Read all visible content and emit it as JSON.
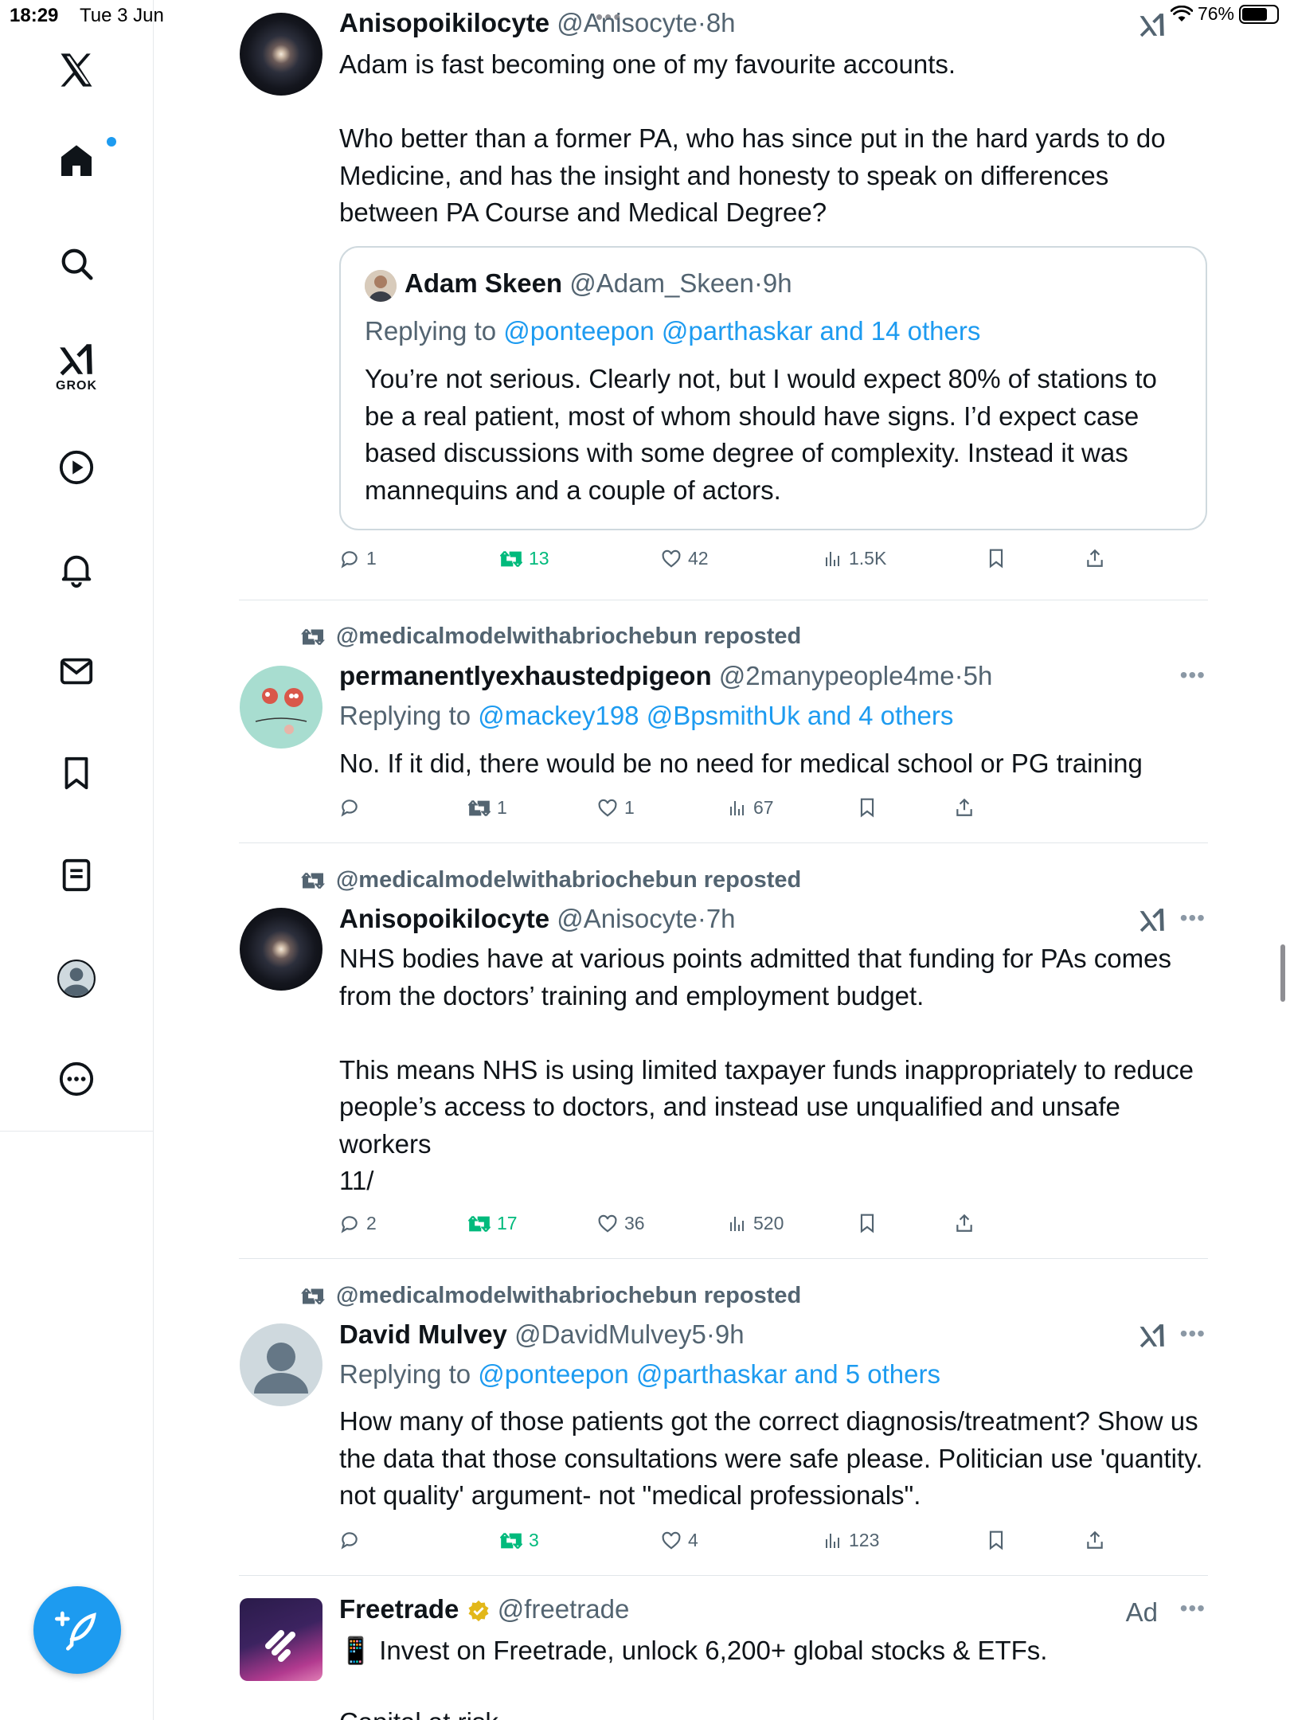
{
  "status_bar": {
    "time": "18:29",
    "date": "Tue 3 Jun",
    "battery": "76%"
  },
  "sidebar": {
    "grok_label": "GROK",
    "items": [
      "x-logo",
      "home",
      "search",
      "grok",
      "video",
      "notifications",
      "messages",
      "bookmarks",
      "lists",
      "profile",
      "more"
    ]
  },
  "tweets": [
    {
      "name": "Anisopoikilocyte",
      "handle": "@Anisocyte",
      "time": "8h",
      "text": "Adam is fast becoming one of my favourite accounts.\n\nWho better than a former PA, who has since put in the hard yards to do Medicine, and has the insight and honesty to speak on differences between PA Course and Medical Degree?",
      "quote": {
        "name": "Adam Skeen",
        "handle": "@Adam_Skeen",
        "time": "9h",
        "replying_prefix": "Replying to ",
        "replying_links": "@ponteepon @parthaskar and 14 others",
        "text": "You’re not serious. Clearly not, but I would expect 80% of stations to be a real patient, most of whom should have signs. I’d expect case based discussions with some degree of complexity. Instead it was mannequins and a couple of actors."
      },
      "stats": {
        "replies": "1",
        "reposts": "13",
        "likes": "42",
        "views": "1.5K"
      }
    },
    {
      "reposted_by": "@medicalmodelwithabriochebun reposted",
      "name": "permanentlyexhaustedpigeon",
      "handle": "@2manypeople4me",
      "time": "5h",
      "replying_prefix": "Replying to ",
      "replying_links": "@mackey198 @BpsmithUk and 4 others",
      "text": "No. If it did, there would be no need for medical school or PG training",
      "stats": {
        "replies": "",
        "reposts": "1",
        "likes": "1",
        "views": "67"
      }
    },
    {
      "reposted_by": "@medicalmodelwithabriochebun reposted",
      "name": "Anisopoikilocyte",
      "handle": "@Anisocyte",
      "time": "7h",
      "text": "NHS bodies have at various points admitted that funding for PAs comes from the doctors’ training and employment budget.\n\nThis means NHS is using limited taxpayer funds inappropriately to reduce people’s access to doctors, and instead use unqualified and unsafe workers\n11/",
      "stats": {
        "replies": "2",
        "reposts": "17",
        "likes": "36",
        "views": "520"
      }
    },
    {
      "reposted_by": "@medicalmodelwithabriochebun reposted",
      "name": "David Mulvey",
      "handle": "@DavidMulvey5",
      "time": "9h",
      "replying_prefix": "Replying to ",
      "replying_links": "@ponteepon @parthaskar and 5 others",
      "text": "How many of those patients got the correct diagnosis/treatment? Show us the data that those consultations were safe please. Politician use 'quantity. not quality' argument- not \"medical professionals\".",
      "stats": {
        "replies": "",
        "reposts": "3",
        "likes": "4",
        "views": "123"
      }
    },
    {
      "name": "Freetrade",
      "handle": "@freetrade",
      "ad_label": "Ad",
      "text": "📱 Invest on Freetrade, unlock 6,200+ global stocks & ETFs.",
      "text_cut": "Capital at risk."
    }
  ],
  "colors": {
    "accent": "#1d9bf0",
    "repost_green": "#00ba7c",
    "muted": "#536471"
  }
}
